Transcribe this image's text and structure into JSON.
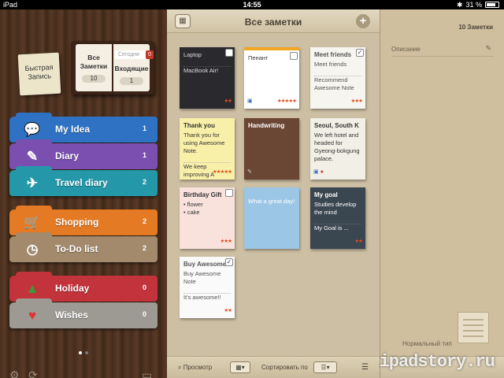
{
  "status": {
    "carrier": "iPad",
    "time": "14:55",
    "battery": "31 %"
  },
  "sidebar": {
    "quick_note": "Быстрая Запись",
    "book": {
      "all_label": "Все Заметки",
      "all_count": "10",
      "inbox_label": "Входящие",
      "inbox_count": "1",
      "today_label": "Сегодня",
      "today_count": "0"
    },
    "folders": [
      {
        "name": "My Idea",
        "count": "1",
        "color": "#2f72c4",
        "icon": "speech-bubble-icon"
      },
      {
        "name": "Diary",
        "count": "1",
        "color": "#7a4fb0",
        "icon": "pen-icon"
      },
      {
        "name": "Travel diary",
        "count": "2",
        "color": "#2498a8",
        "icon": "airplane-icon"
      },
      {
        "name": "Shopping",
        "count": "2",
        "color": "#e47a24",
        "icon": "cart-icon"
      },
      {
        "name": "To-Do list",
        "count": "2",
        "color": "#a48a6c",
        "icon": "clock-icon"
      },
      {
        "name": "Holiday",
        "count": "0",
        "color": "#c2333b",
        "icon": "tree-icon"
      },
      {
        "name": "Wishes",
        "count": "0",
        "color": "#9d9a94",
        "icon": "stocking-icon"
      }
    ]
  },
  "main": {
    "title": "Все заметки",
    "notes": [
      {
        "title": "",
        "body": "Laptop",
        "body2": "MacBook Air!",
        "stars": "★★",
        "bg": "#2a2a2e",
        "fg": "#ddd"
      },
      {
        "title": "",
        "body": "Пенант",
        "body2": "",
        "stars": "★★★★★",
        "bg": "#ffffff",
        "fg": "#333"
      },
      {
        "title": "Meet friends",
        "body": "Meet friends",
        "body2": "Recommend Awesome Note",
        "stars": "★★★",
        "bg": "#f7f5ef",
        "fg": "#555"
      },
      {
        "title": "Thank you",
        "body": "Thank you for using Awesome Note.",
        "body2": "We keep improving A",
        "stars": "★★★★★",
        "bg": "#f8f0a8",
        "fg": "#333"
      },
      {
        "title": "Handwriting",
        "body": "",
        "body2": "",
        "stars": "",
        "bg": "#6a4634",
        "fg": "#fff"
      },
      {
        "title": "Seoul, South K",
        "body": "We left hotel and headed for Gyeong-bokgung palace.",
        "body2": "",
        "stars": "",
        "bg": "#f2efe6",
        "fg": "#333"
      },
      {
        "title": "Birthday Gift",
        "body": "• flower",
        "body2": "• cake",
        "stars": "★★★",
        "bg": "#f9e2dc",
        "fg": "#333"
      },
      {
        "title": "",
        "body": "What a great day!",
        "body2": "",
        "stars": "",
        "bg": "#9cc6e6",
        "fg": "#fff"
      },
      {
        "title": "My goal",
        "body": "Studies develop the mind",
        "body2": "My Goal is ...",
        "stars": "★★",
        "bg": "#3a4650",
        "fg": "#fff"
      },
      {
        "title": "Buy Awesome",
        "body": "Buy Awesome Note",
        "body2": "It's awesome!!",
        "stars": "★★",
        "bg": "#fafafa",
        "fg": "#555"
      }
    ],
    "footer": {
      "search": "Просмотр",
      "sort": "Сортировать по"
    }
  },
  "detail": {
    "count": "10 Заметки",
    "description": "Описание",
    "note_type": "Нормальный тип"
  },
  "watermark": "ipadstory.ru"
}
